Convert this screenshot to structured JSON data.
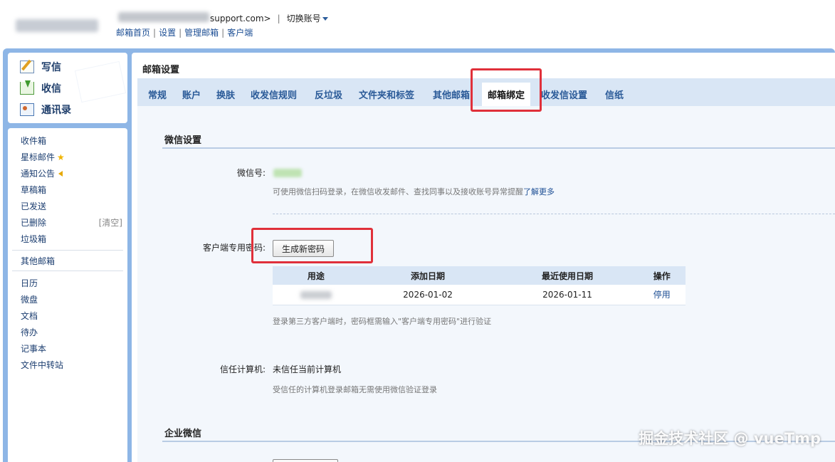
{
  "header": {
    "account_suffix": "support.com>",
    "switch_account": "切换账号",
    "links": [
      "邮箱首页",
      "设置",
      "管理邮箱",
      "客户端"
    ]
  },
  "sidebar": {
    "quick": [
      {
        "label": "写信",
        "icon": "write-icon"
      },
      {
        "label": "收信",
        "icon": "receive-icon"
      },
      {
        "label": "通讯录",
        "icon": "contacts-icon"
      }
    ],
    "folders": [
      "收件箱",
      "星标邮件",
      "通知公告",
      "草稿箱",
      "已发送",
      "已删除",
      "垃圾箱"
    ],
    "clear_label": "[清空]",
    "other_mailbox": "其他邮箱",
    "apps": [
      "日历",
      "微盘",
      "文档",
      "待办",
      "记事本",
      "文件中转站"
    ]
  },
  "main": {
    "title": "邮箱设置",
    "tabs": [
      "常规",
      "账户",
      "换肤",
      "收发信规则",
      "反垃圾",
      "文件夹和标签",
      "其他邮箱",
      "邮箱绑定",
      "收发信设置",
      "信纸"
    ],
    "active_tab": "邮箱绑定"
  },
  "wechat": {
    "section_title": "微信设置",
    "wechat_id_label": "微信号:",
    "hint": "可使用微信扫码登录，在微信收发邮件、查找同事以及接收账号异常提醒",
    "learn_more": "了解更多"
  },
  "client_password": {
    "label": "客户端专用密码:",
    "generate_button": "生成新密码",
    "columns": [
      "用途",
      "添加日期",
      "最近使用日期",
      "操作"
    ],
    "rows": [
      {
        "added": "2026-01-02",
        "last_used": "2026-01-11",
        "action": "停用"
      }
    ],
    "hint": "登录第三方客户端时，密码框需输入\"客户端专用密码\"进行验证"
  },
  "trusted_pc": {
    "label": "信任计算机:",
    "value": "未信任当前计算机",
    "hint": "受信任的计算机登录邮箱无需使用微信验证登录"
  },
  "enterprise_wechat": {
    "section_title": "企业微信"
  },
  "watermark": "掘金技术社区 @ vueTmp",
  "colors": {
    "frame_blue": "#8eb6e6",
    "tab_bar": "#d9e6f5",
    "link_blue": "#1c4e94",
    "highlight_red": "#e0303a"
  }
}
